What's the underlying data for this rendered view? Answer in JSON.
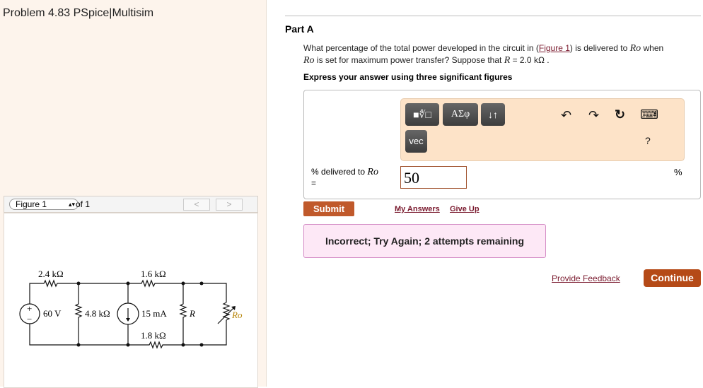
{
  "left": {
    "title": "Problem 4.83 PSpice|Multisim",
    "figure_select": "Figure 1",
    "of_label": "of 1",
    "prev": "<",
    "next": ">",
    "circuit": {
      "r1": "2.4 kΩ",
      "r2": "1.6 kΩ",
      "source_v": "60 V",
      "r3": "4.8 kΩ",
      "source_i": "15 mA",
      "r_label": "R",
      "r4": "1.8 kΩ",
      "ro_label": "Ro",
      "plus": "+",
      "minus": "−"
    }
  },
  "part": {
    "title": "Part A",
    "q1": "What percentage of the total power developed in the circuit in (",
    "fig_link": "Figure 1",
    "q2": ") is delivered to ",
    "ro": "Ro",
    "q3": " when",
    "q4": " is set for maximum power transfer? Suppose that ",
    "r": "R",
    "q5": " = 2.0  kΩ .",
    "express": "Express your answer using three significant figures"
  },
  "toolbar": {
    "templates": "■∜□",
    "greek": "ΑΣφ",
    "arrows": "↓↑",
    "vec": "vec",
    "undo": "↶",
    "redo": "↷",
    "reset": "↻",
    "keyboard": "⌨",
    "help": "?"
  },
  "answer": {
    "label": "% delivered to ",
    "label_ro": "Ro",
    "equals": "=",
    "value": "50",
    "unit": "%"
  },
  "actions": {
    "submit": "Submit",
    "my_answers": "My Answers",
    "give_up": "Give Up"
  },
  "feedback": {
    "message": "Incorrect; Try Again; 2 attempts remaining",
    "provide_feedback": "Provide Feedback",
    "continue": "Continue"
  }
}
